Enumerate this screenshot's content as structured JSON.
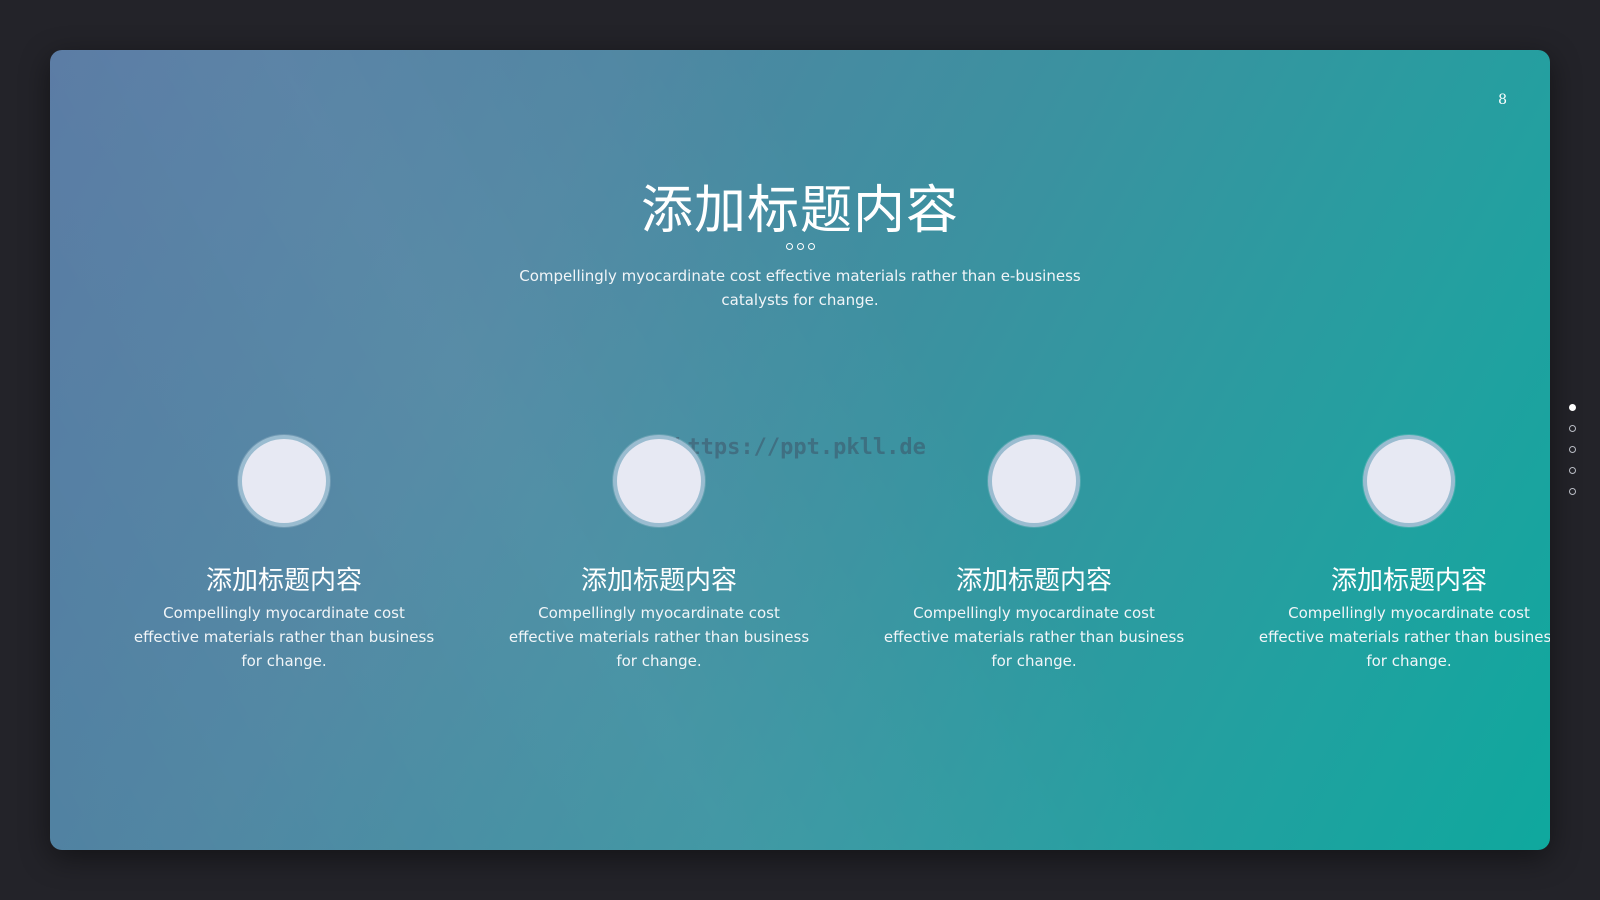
{
  "slide": {
    "page_number": "8",
    "title": "添加标题内容",
    "subtitle": "Compellingly myocardinate cost effective materials rather than e-business catalysts for change.",
    "watermark": "https://ppt.pkll.de",
    "gradient_start": "#5678a2",
    "gradient_end": "#0fa89e"
  },
  "features": [
    {
      "title": "添加标题内容",
      "description": "Compellingly myocardinate cost effective materials rather than business for change."
    },
    {
      "title": "添加标题内容",
      "description": "Compellingly myocardinate cost effective materials rather than business for change."
    },
    {
      "title": "添加标题内容",
      "description": "Compellingly myocardinate cost effective materials rather than business for change."
    },
    {
      "title": "添加标题内容",
      "description": "Compellingly myocardinate cost effective materials rather than business for change."
    }
  ],
  "navigation": {
    "slide_count": 5,
    "active_index": 0
  }
}
